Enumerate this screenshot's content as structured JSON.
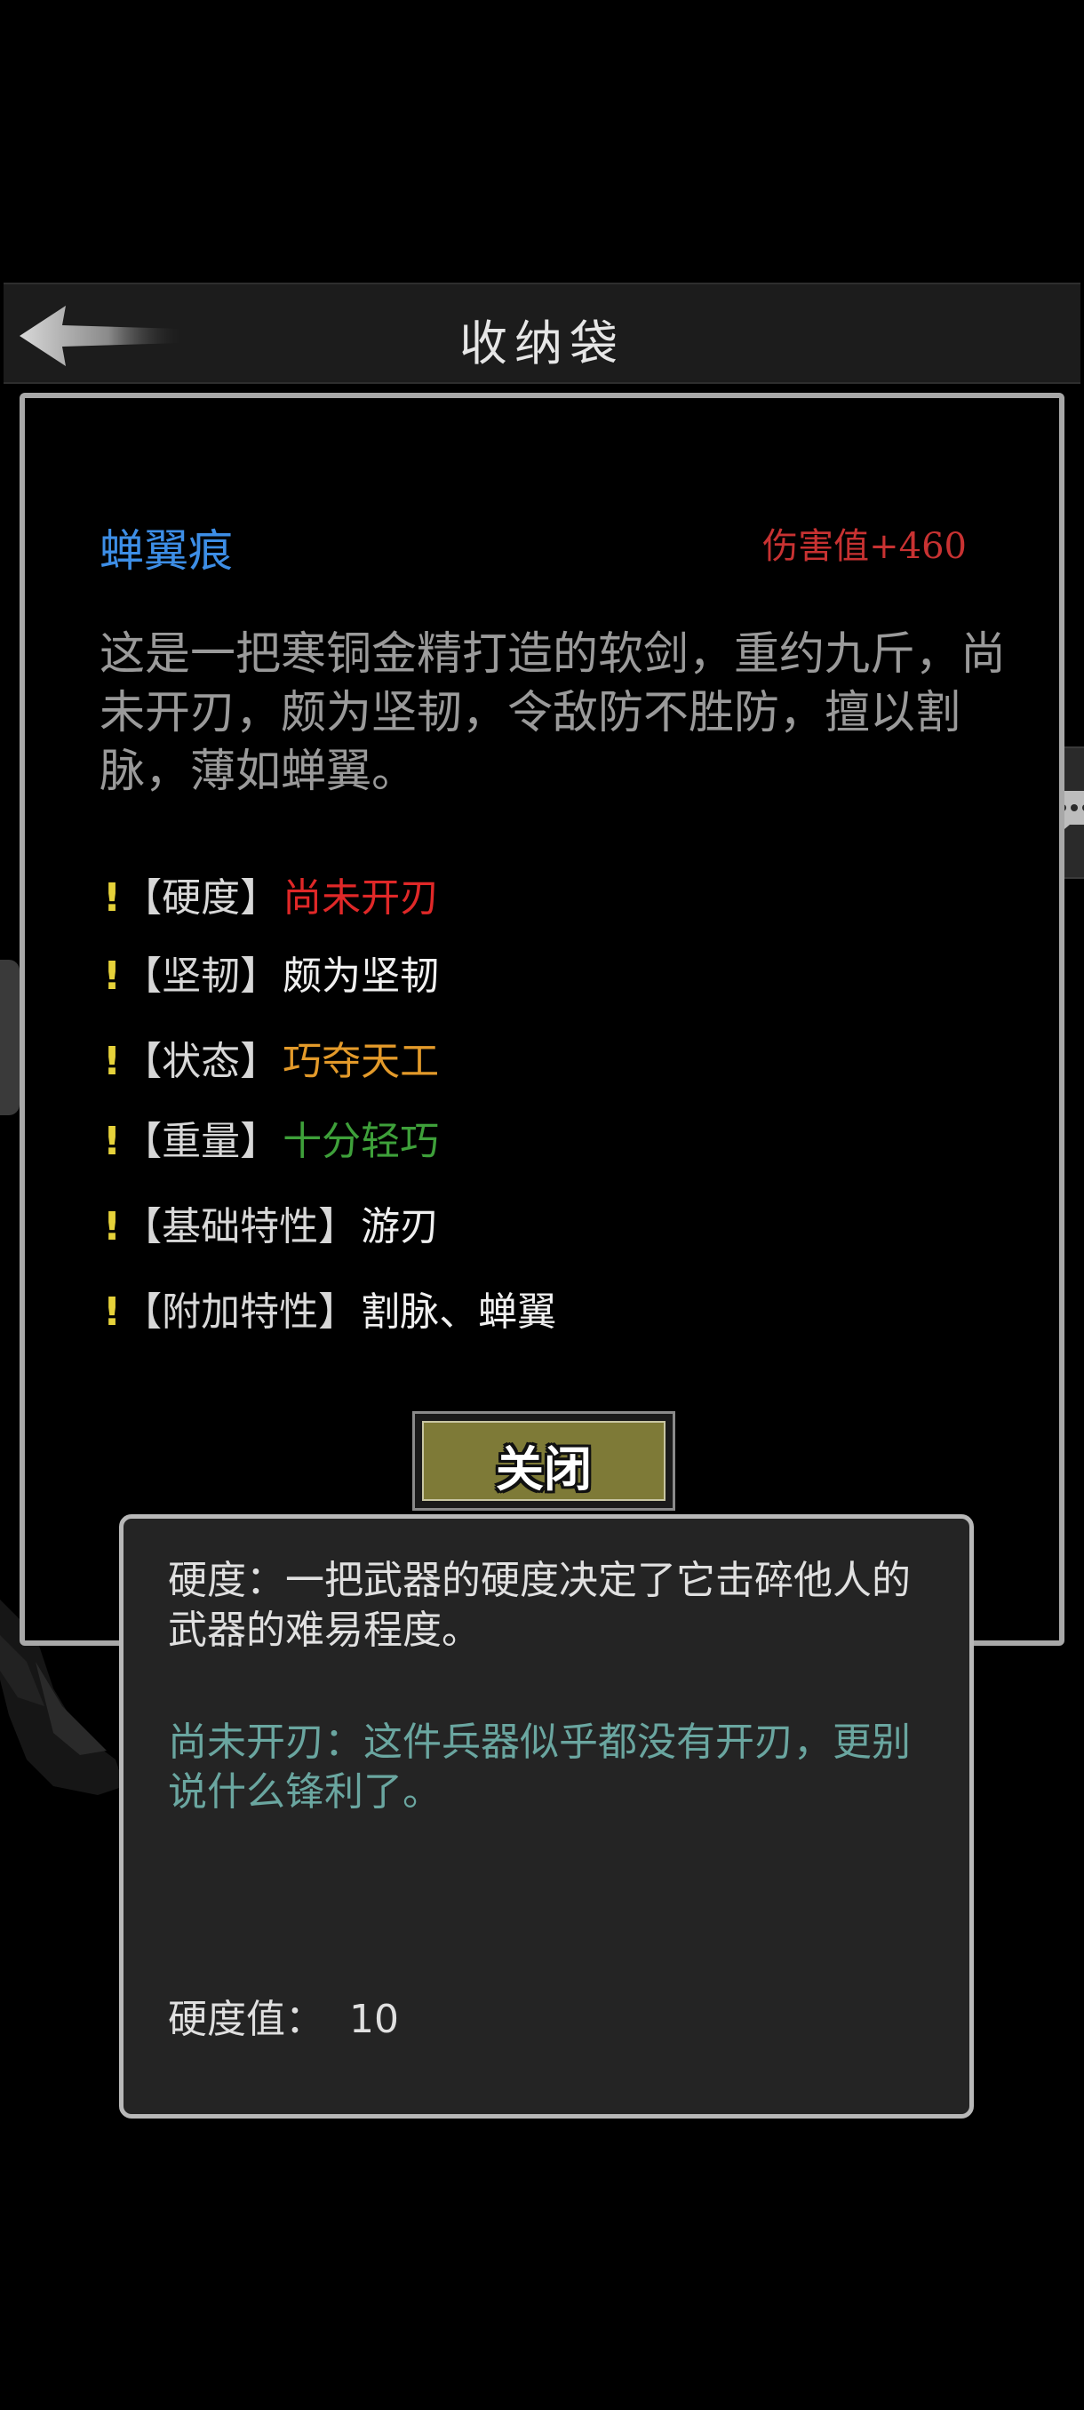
{
  "header": {
    "title": "收纳袋"
  },
  "item": {
    "name": "蝉翼痕",
    "damage": "伤害值+460",
    "description": "这是一把寒铜金精打造的软剑，重约九斤，尚未开刃，颇为坚韧，令敌防不胜防，擅以割脉，薄如蝉翼。",
    "attributes": [
      {
        "marker": "!",
        "key": "【硬度】",
        "value": "尚未开刃",
        "color": "#e02828"
      },
      {
        "marker": "!",
        "key": "【坚韧】",
        "value": "颇为坚韧",
        "color": "#f0f0f0"
      },
      {
        "marker": "!",
        "key": "【状态】",
        "value": "巧夺天工",
        "color": "#e39a2a"
      },
      {
        "marker": "!",
        "key": "【重量】",
        "value": "十分轻巧",
        "color": "#3ea03a"
      },
      {
        "marker": "!",
        "key": "【基础特性】",
        "value": "游刃",
        "color": "#f0f0f0"
      },
      {
        "marker": "!",
        "key": "【附加特性】",
        "value": "割脉、蝉翼",
        "color": "#f0f0f0"
      }
    ],
    "close_label": "关闭"
  },
  "tooltip": {
    "definition": "硬度：一把武器的硬度决定了它击碎他人的武器的难易程度。",
    "level_desc": "尚未开刃：这件兵器似乎都没有开刃，更别说什么锋利了。",
    "value_text": "硬度值：  10"
  },
  "icons": {
    "back": "arrow-left-icon",
    "chat": "chat-bubble-icon"
  },
  "colors": {
    "item_name": "#3d8ee6",
    "damage": "#c83232",
    "description": "#9a9a9a",
    "tooltip_plain": "#e0e0e0",
    "tooltip_accent": "#6aa6a0",
    "button_fill": "#7e7a37"
  }
}
